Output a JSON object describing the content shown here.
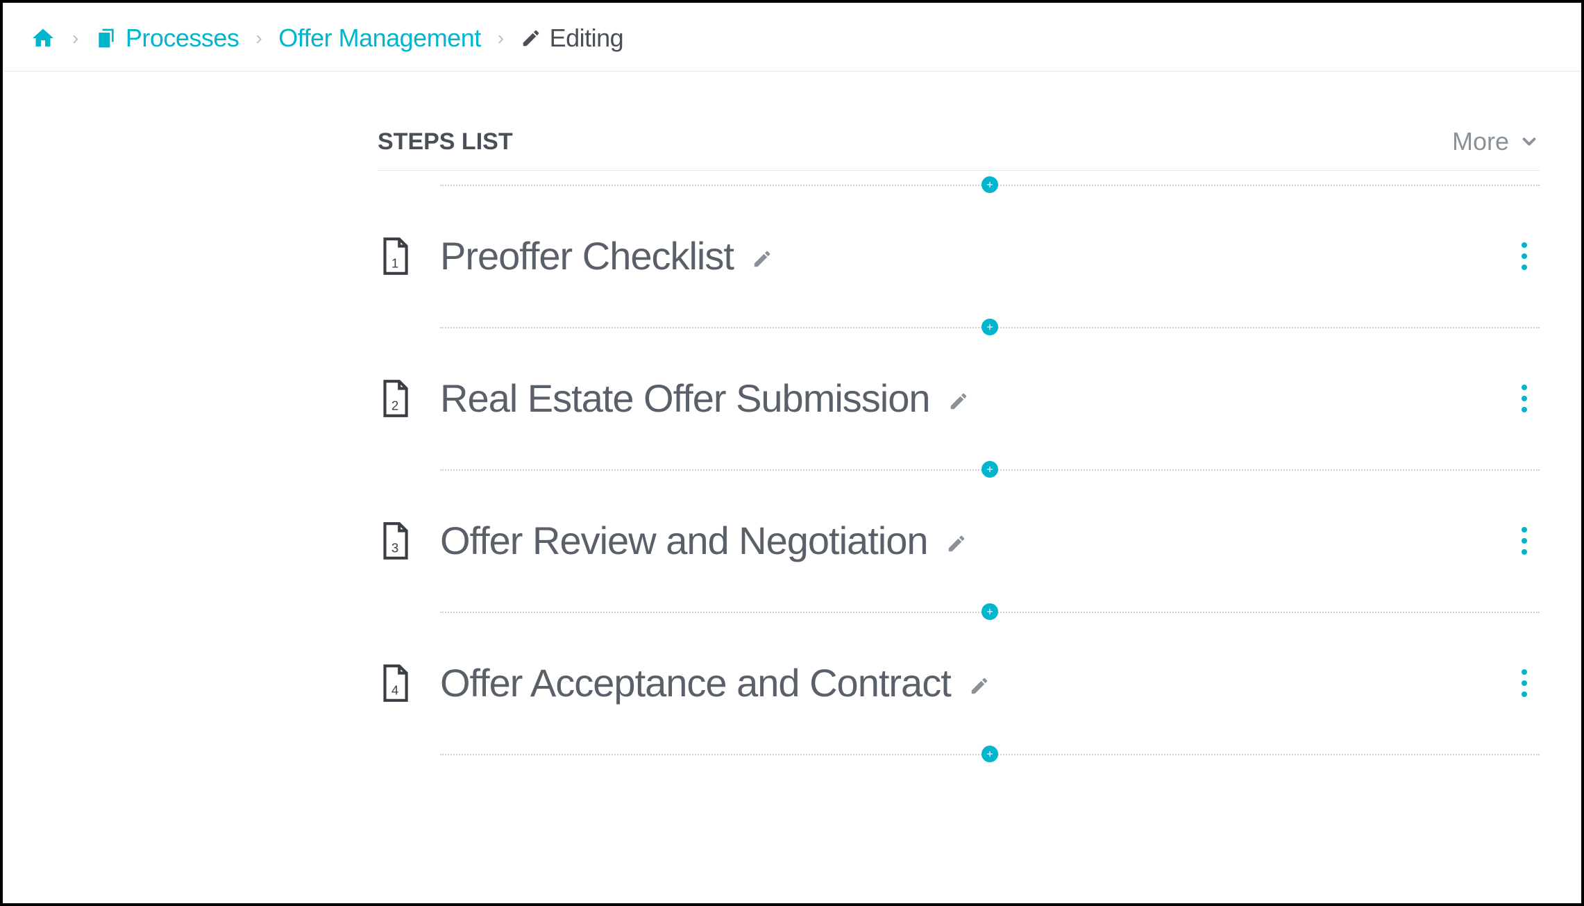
{
  "breadcrumb": {
    "home_label": "Home",
    "processes_label": "Processes",
    "offer_mgmt_label": "Offer Management",
    "editing_label": "Editing"
  },
  "header": {
    "title": "STEPS LIST",
    "more_label": "More"
  },
  "steps": [
    {
      "num": "1",
      "title": "Preoffer Checklist"
    },
    {
      "num": "2",
      "title": "Real Estate Offer Submission"
    },
    {
      "num": "3",
      "title": "Offer Review and Negotiation"
    },
    {
      "num": "4",
      "title": "Offer Acceptance and Contract"
    }
  ],
  "colors": {
    "accent": "#00b5cc",
    "text": "#4a4f57",
    "muted": "#8a9199"
  }
}
